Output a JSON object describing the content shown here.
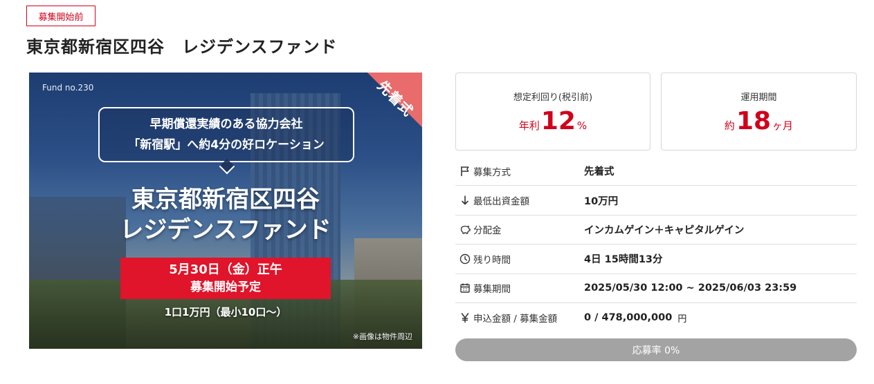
{
  "header": {
    "status_badge": "募集開始前",
    "title": "東京都新宿区四谷　レジデンスファンド"
  },
  "hero": {
    "fund_no": "Fund no.230",
    "corner_label": "先着式",
    "bubble_line1": "早期償還実績のある協力会社",
    "bubble_line2": "「新宿駅」へ約4分の好ロケーション",
    "title_line1": "東京都新宿区四谷",
    "title_line2": "レジデンスファンド",
    "date_line1": "5月30日（金）正午",
    "date_line2": "募集開始予定",
    "unit_note": "1口1万円（最小10口〜）",
    "photo_note": "※画像は物件周辺"
  },
  "stats": {
    "yield": {
      "label": "想定利回り(税引前)",
      "prefix": "年利",
      "value": "12",
      "suffix": "%"
    },
    "term": {
      "label": "運用期間",
      "prefix": "約",
      "value": "18",
      "suffix": "ヶ月"
    }
  },
  "details": [
    {
      "icon": "flag-icon",
      "key": "募集方式",
      "value": "先着式",
      "unit": ""
    },
    {
      "icon": "arrow-down-icon",
      "key": "最低出資金額",
      "value": "10万円",
      "unit": ""
    },
    {
      "icon": "piggy-bank-icon",
      "key": "分配金",
      "value": "インカムゲイン＋キャピタルゲイン",
      "unit": ""
    },
    {
      "icon": "clock-icon",
      "key": "残り時間",
      "value": "4日 15時間13分",
      "unit": ""
    },
    {
      "icon": "calendar-icon",
      "key": "募集期間",
      "value": "2025/05/30 12:00 ~ 2025/06/03 23:59",
      "unit": ""
    },
    {
      "icon": "yen-icon",
      "key": "申込金額 / 募集金額",
      "value": "0 / 478,000,000",
      "unit": "円"
    }
  ],
  "progress": {
    "label": "応募率 0%",
    "percent": 0
  },
  "colors": {
    "accent": "#d0021b",
    "progress_track": "#a3a3a3",
    "corner": "#e96b6b"
  }
}
